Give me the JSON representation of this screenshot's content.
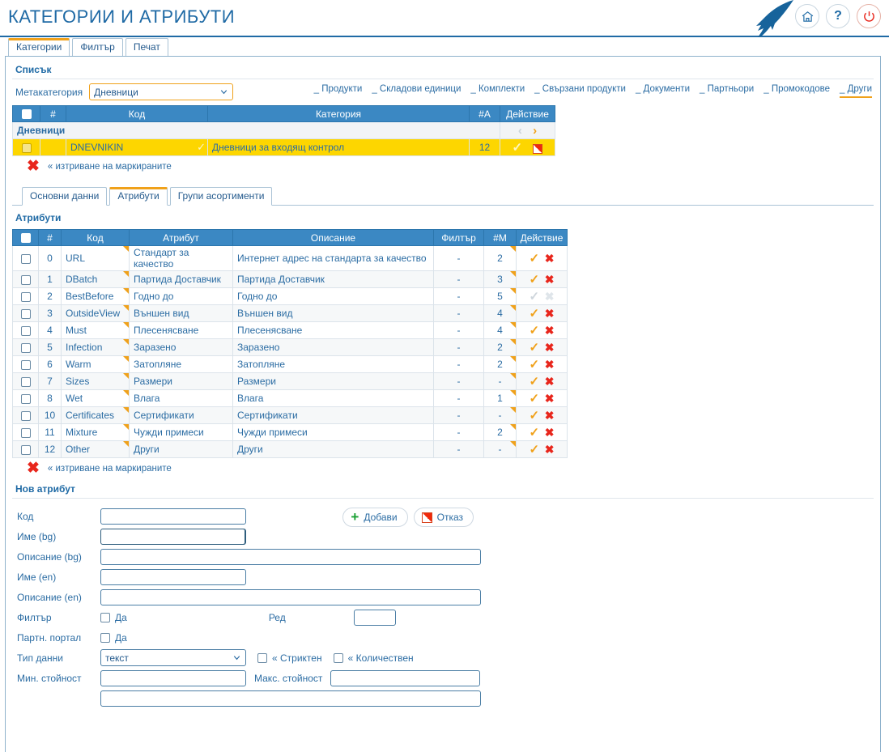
{
  "header": {
    "title": "КАТЕГОРИИ И АТРИБУТИ",
    "icons": [
      {
        "name": "home-icon",
        "glyph": "⌂"
      },
      {
        "name": "help-icon",
        "glyph": "?"
      },
      {
        "name": "power-icon",
        "glyph": "⏻"
      }
    ],
    "accent_orange": "#f0a11a",
    "brand_blue": "#1f6aa5"
  },
  "tabs": [
    {
      "label": "Категории",
      "active": true
    },
    {
      "label": "Филтър",
      "active": false
    },
    {
      "label": "Печат",
      "active": false
    }
  ],
  "list_section": {
    "title": "Списък",
    "meta_label": "Метакатегория",
    "meta_value": "Дневници",
    "meta_options": [
      "Дневници"
    ],
    "sublinks": [
      {
        "label": "_ Продукти",
        "active": false
      },
      {
        "label": "_ Складови единици",
        "active": false
      },
      {
        "label": "_ Комплекти",
        "active": false
      },
      {
        "label": "_ Свързани продукти",
        "active": false
      },
      {
        "label": "_ Документи",
        "active": false
      },
      {
        "label": "_ Партньори",
        "active": false
      },
      {
        "label": "_ Промокодове",
        "active": false
      },
      {
        "label": "_ Други",
        "active": true
      }
    ],
    "columns": [
      "",
      "#",
      "Код",
      "Категория",
      "#A",
      "Действие"
    ],
    "group_row": "Дневници",
    "rows": [
      {
        "num": "",
        "code": "DNEVNIKIN",
        "category": "Дневници за входящ контрол",
        "count": "12",
        "selected": true
      }
    ],
    "delete_marked": "« изтриване на маркираните"
  },
  "inner_tabs": [
    {
      "label": "Основни данни",
      "active": false
    },
    {
      "label": "Атрибути",
      "active": true
    },
    {
      "label": "Групи асортименти",
      "active": false
    }
  ],
  "attributes_section": {
    "title": "Атрибути",
    "columns": [
      "",
      "#",
      "Код",
      "Атрибут",
      "Описание",
      "Филтър",
      "#M",
      "Действие"
    ],
    "rows": [
      {
        "num": "0",
        "code": "URL",
        "attr": "Стандарт за качество",
        "desc": "Интернет адрес на стандарта за качество",
        "filter": "-",
        "m": "2",
        "code_red": false,
        "deletable": true
      },
      {
        "num": "1",
        "code": "DBatch",
        "attr": "Партида Доставчик",
        "desc": "Партида Доставчик",
        "filter": "-",
        "m": "3",
        "code_red": false,
        "deletable": true
      },
      {
        "num": "2",
        "code": "BestBefore",
        "attr": "Годно до",
        "desc": "Годно до",
        "filter": "-",
        "m": "5",
        "code_red": true,
        "deletable": false
      },
      {
        "num": "3",
        "code": "OutsideView",
        "attr": "Външен вид",
        "desc": "Външен вид",
        "filter": "-",
        "m": "4",
        "code_red": false,
        "deletable": true
      },
      {
        "num": "4",
        "code": "Must",
        "attr": "Плесенясване",
        "desc": "Плесенясване",
        "filter": "-",
        "m": "4",
        "code_red": false,
        "deletable": true
      },
      {
        "num": "5",
        "code": "Infection",
        "attr": "Заразено",
        "desc": "Заразено",
        "filter": "-",
        "m": "2",
        "code_red": false,
        "deletable": true
      },
      {
        "num": "6",
        "code": "Warm",
        "attr": "Затопляне",
        "desc": "Затопляне",
        "filter": "-",
        "m": "2",
        "code_red": false,
        "deletable": true
      },
      {
        "num": "7",
        "code": "Sizes",
        "attr": "Размери",
        "desc": "Размери",
        "filter": "-",
        "m": "-",
        "code_red": false,
        "deletable": true
      },
      {
        "num": "8",
        "code": "Wet",
        "attr": "Влага",
        "desc": "Влага",
        "filter": "-",
        "m": "1",
        "code_red": false,
        "deletable": true
      },
      {
        "num": "10",
        "code": "Certificates",
        "attr": "Сертификати",
        "desc": "Сертификати",
        "filter": "-",
        "m": "-",
        "code_red": false,
        "deletable": true
      },
      {
        "num": "11",
        "code": "Mixture",
        "attr": "Чужди примеси",
        "desc": "Чужди примеси",
        "filter": "-",
        "m": "2",
        "code_red": false,
        "deletable": true
      },
      {
        "num": "12",
        "code": "Other",
        "attr": "Други",
        "desc": "Други",
        "filter": "-",
        "m": "-",
        "code_red": false,
        "deletable": true
      }
    ],
    "delete_marked": "« изтриване на маркираните"
  },
  "new_attribute": {
    "title": "Нов атрибут",
    "add_button": "Добави",
    "cancel_button": "Отказ",
    "fields": {
      "code_label": "Код",
      "code_value": "",
      "name_bg_label": "Име (bg)",
      "name_bg_value": "",
      "desc_bg_label": "Описание (bg)",
      "desc_bg_value": "",
      "name_en_label": "Име (en)",
      "name_en_value": "",
      "desc_en_label": "Описание (en)",
      "desc_en_value": "",
      "filter_label": "Филтър",
      "filter_yes": "Да",
      "order_label": "Ред",
      "order_value": "",
      "portal_label": "Партн. портал",
      "portal_yes": "Да",
      "datatype_label": "Тип данни",
      "datatype_value": "текст",
      "datatype_options": [
        "текст"
      ],
      "strict_label": "« Стриктен",
      "quantitative_label": "« Количествен",
      "min_label": "Мин. стойност",
      "min_value": "",
      "max_label": "Макс. стойност",
      "max_value": ""
    }
  }
}
